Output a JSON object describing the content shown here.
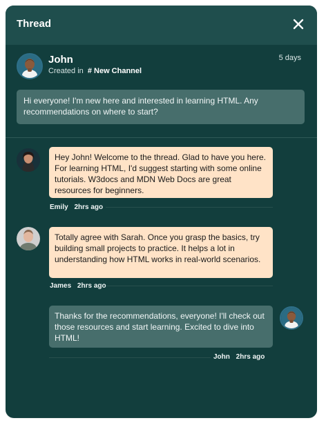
{
  "header": {
    "title": "Thread"
  },
  "original_post": {
    "author": "John",
    "created_in_text": "Created in",
    "channel": "# New Channel",
    "time": "5 days",
    "message": "Hi everyone! I'm new here and interested in learning HTML. Any recommendations on where to start?"
  },
  "replies": [
    {
      "author": "Emily",
      "time": "2hrs ago",
      "message": "Hey John! Welcome to the thread. Glad to have you here. For learning HTML, I'd suggest starting with some online tutorials. W3docs and MDN Web Docs are great resources for beginners."
    },
    {
      "author": "James",
      "time": "2hrs ago",
      "message": "Totally agree with Sarah. Once you grasp the basics, try building small projects to practice. It helps a lot in understanding how HTML works in real-world scenarios."
    },
    {
      "author": "John",
      "time": "2hrs ago",
      "message": "Thanks for the recommendations, everyone! I'll check out those resources and start learning. Excited to dive into HTML!"
    }
  ],
  "colors": {
    "panel_bg": "#123e3d",
    "header_bg": "#1f4e4d",
    "peach_bubble": "#ffe3c7",
    "dark_bubble": "#476e6c"
  }
}
